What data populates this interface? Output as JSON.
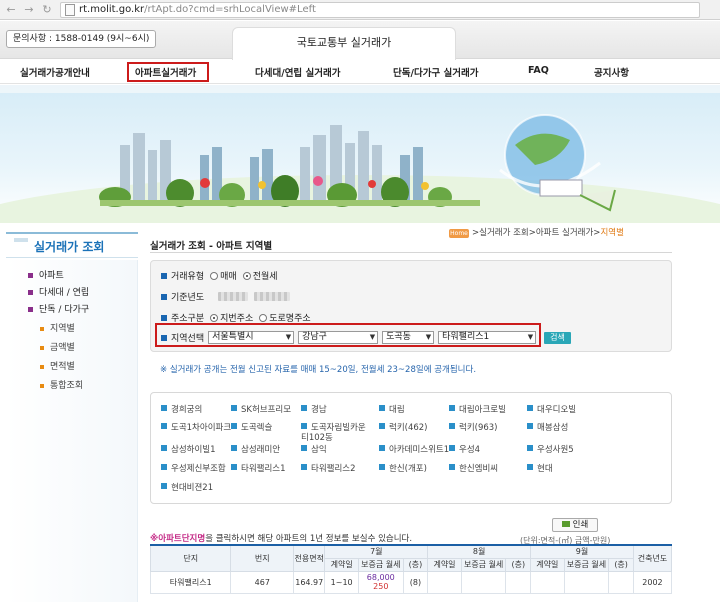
{
  "browser": {
    "url_host": "rt.molit.go.kr",
    "url_path": "/rtApt.do?cmd=srhLocalView#Left"
  },
  "header": {
    "inquiry": "문의사항 : 1588-0149 (9시~6시)",
    "site_title": "국토교통부 실거래가"
  },
  "nav": {
    "items": [
      "실거래가공개안내",
      "아파트실거래가",
      "다세대/연립 실거래가",
      "단독/다가구 실거래가",
      "FAQ",
      "공지사항"
    ]
  },
  "sidebar": {
    "title": "실거래가 조회",
    "items": [
      {
        "label": "아파트",
        "level": 1
      },
      {
        "label": "다세대 / 연립",
        "level": 1
      },
      {
        "label": "단독 / 다가구",
        "level": 1
      },
      {
        "label": "지역별",
        "level": 2
      },
      {
        "label": "금액별",
        "level": 2
      },
      {
        "label": "면적별",
        "level": 2
      },
      {
        "label": "통합조회",
        "level": 2
      }
    ]
  },
  "breadcrumb": {
    "home": "Home",
    "path": ">실거래가 조회>아파트 실거래가>",
    "current": "지역별"
  },
  "content": {
    "title": "실거래가 조회 - 아파트 지역별",
    "form": {
      "deal_type_label": "거래유형",
      "deal_opt1": "매매",
      "deal_opt2": "전월세",
      "year_label": "기준년도",
      "addr_type_label": "주소구분",
      "addr_opt1": "지번주소",
      "addr_opt2": "도로명주소",
      "region_label": "지역선택",
      "sido": "서울특별시",
      "sigungu": "강남구",
      "dong": "도곡동",
      "apt": "타워팰리스1",
      "search_button": "검색"
    },
    "notice": "※ 실거래가 공개는 전월 신고된 자료를 매매 15~20일, 전월세 23~28일에 공개됩니다.",
    "apartments": [
      [
        "경희궁의",
        "SK허브프리모",
        "경남",
        "대림",
        "대림아크로빌",
        "대우디오빌"
      ],
      [
        "도곡1차아이파크",
        "도곡렉슬",
        "도곡자림빌카운티102동",
        "럭키(462)",
        "럭키(963)",
        "매봉삼성"
      ],
      [
        "삼성하이빌1",
        "삼성래미안",
        "삼익",
        "아카데미스위트1",
        "우성4",
        "우성사원5"
      ],
      [
        "우성제신부조합",
        "타워팰리스1",
        "타워팰리스2",
        "한신(개포)",
        "한신엠비씨",
        "현대"
      ],
      [
        "현대비젼21"
      ]
    ],
    "below_note_emph": "※아파트단지명",
    "below_note_rest": "을 클릭하시면 해당 아파트의 1년 정보를 보실수 있습니다.",
    "print_label": "인쇄",
    "unit_note": "(단위:면적-(㎡) 금액-만원)"
  },
  "table": {
    "col_complex": "단지",
    "col_lot": "번지",
    "col_area": "전용면적",
    "months": [
      "7월",
      "8월",
      "9월"
    ],
    "sub_contract": "계약일",
    "sub_deposit": "보증금 월세",
    "sub_floor": "(층)",
    "col_year": "건축년도",
    "rows": [
      {
        "complex": "타워팰리스1",
        "lot": "467",
        "area": "164.97",
        "m7_day": "1~10",
        "m7_deposit": "68,000",
        "m7_monthly": "250",
        "m7_floor": "(8)",
        "m8_day": "",
        "m8_deposit": "",
        "m8_floor": "",
        "m9_day": "",
        "m9_deposit": "",
        "m9_floor": "",
        "year": "2002"
      }
    ]
  }
}
